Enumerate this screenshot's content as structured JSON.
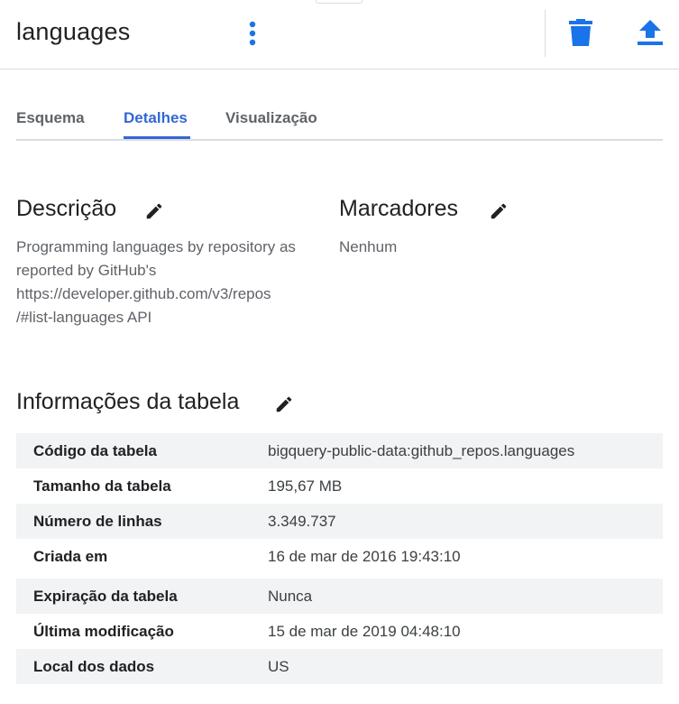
{
  "header": {
    "title": "languages",
    "more_icon": "more-vert-icon",
    "delete_icon": "delete-icon",
    "export_icon": "upload-icon"
  },
  "tabs": [
    {
      "label": "Esquema",
      "active": false
    },
    {
      "label": "Detalhes",
      "active": true
    },
    {
      "label": "Visualização",
      "active": false
    }
  ],
  "description": {
    "title": "Descrição",
    "lines": [
      "Programming languages by repository as",
      "reported by GitHub's",
      "https://developer.github.com/v3/repos",
      "/#list-languages API"
    ]
  },
  "labels": {
    "title": "Marcadores",
    "value": "Nenhum"
  },
  "table_info": {
    "title": "Informações da tabela",
    "rows": [
      {
        "key": "Código da tabela",
        "value": "bigquery-public-data:github_repos.languages"
      },
      {
        "key": "Tamanho da tabela",
        "value": "195,67 MB"
      },
      {
        "key": "Número de linhas",
        "value": "3.349.737"
      },
      {
        "key": "Criada em",
        "value": "16 de mar de 2016 19:43:10"
      },
      {
        "key": "Expiração da tabela",
        "value": "Nunca"
      },
      {
        "key": "Última modificação",
        "value": "15 de mar de 2019 04:48:10"
      },
      {
        "key": "Local dos dados",
        "value": "US"
      }
    ]
  },
  "colors": {
    "accent": "#3367d6",
    "icon": "#1a73e8",
    "edit_icon": "#202124",
    "row_shade": "#f1f3f4",
    "secondary_text": "#5f6368"
  }
}
